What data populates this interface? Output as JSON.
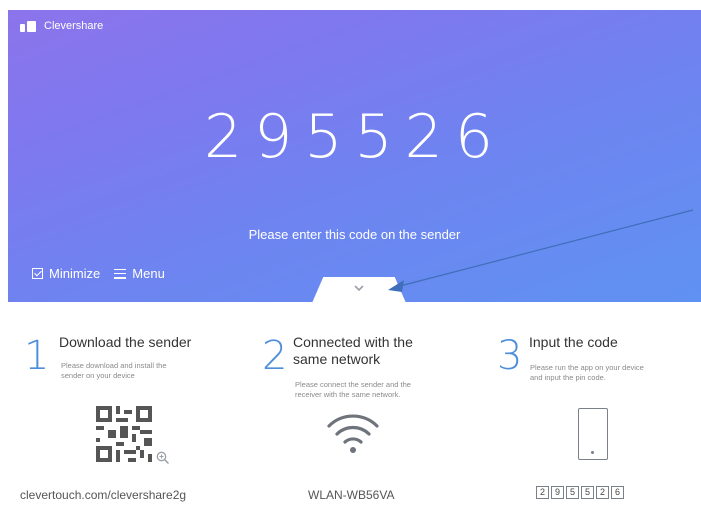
{
  "app": {
    "name": "Clevershare"
  },
  "hero": {
    "code": "295526",
    "instruction": "Please enter this code on the sender"
  },
  "controls": {
    "minimize_label": "Minimize",
    "menu_label": "Menu"
  },
  "steps": [
    {
      "number": "1",
      "title_line1": "Download the sender",
      "title_line2": "",
      "desc_line1": "Please download and install the",
      "desc_line2": "sender on your device",
      "value": "clevertouch.com/clevershare2g",
      "icon": "qr-code-icon"
    },
    {
      "number": "2",
      "title_line1": "Connected with the",
      "title_line2": "same network",
      "desc_line1": "Please connect the sender and the",
      "desc_line2": "receiver with the same network.",
      "value": "WLAN-WB56VA",
      "icon": "wifi-icon"
    },
    {
      "number": "3",
      "title_line1": "Input the code",
      "title_line2": "",
      "desc_line1": "Please run the app on your device",
      "desc_line2": "and input the pin code.",
      "value": "",
      "icon": "phone-icon"
    }
  ],
  "pin_digits": [
    "2",
    "9",
    "5",
    "5",
    "2",
    "6"
  ],
  "colors": {
    "hero_top": "#8c74ec",
    "hero_bottom": "#5f92f2",
    "step_number": "#4d8ed8",
    "annotation_arrow": "#3f6fb8"
  }
}
